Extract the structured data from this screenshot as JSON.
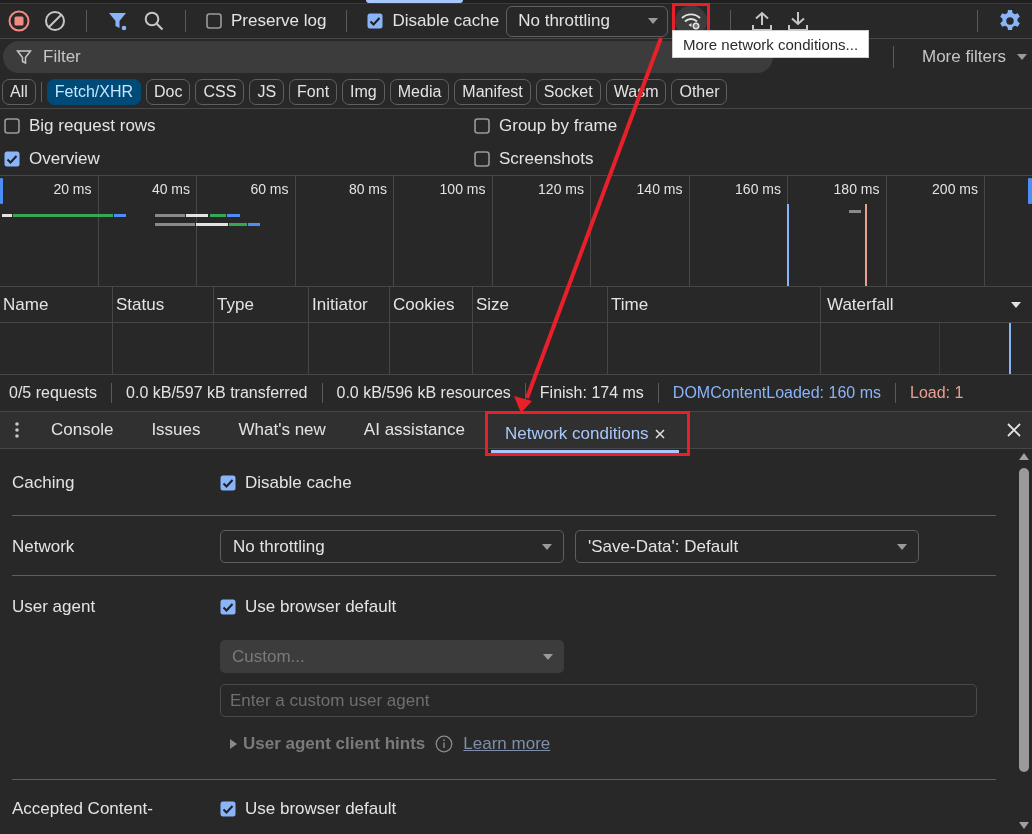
{
  "toolbar": {
    "recording": true,
    "preserve_log": {
      "label": "Preserve log",
      "checked": false
    },
    "disable_cache": {
      "label": "Disable cache",
      "checked": true
    },
    "throttling": "No throttling",
    "conditions_button": {
      "highlighted": true
    },
    "tooltip": "More network conditions..."
  },
  "filter": {
    "placeholder": "Filter",
    "more_filters": "More filters"
  },
  "type_filters": [
    {
      "label": "All",
      "selected": false
    },
    {
      "label": "Fetch/XHR",
      "selected": true
    },
    {
      "label": "Doc",
      "selected": false
    },
    {
      "label": "CSS",
      "selected": false
    },
    {
      "label": "JS",
      "selected": false
    },
    {
      "label": "Font",
      "selected": false
    },
    {
      "label": "Img",
      "selected": false
    },
    {
      "label": "Media",
      "selected": false
    },
    {
      "label": "Manifest",
      "selected": false
    },
    {
      "label": "Socket",
      "selected": false
    },
    {
      "label": "Wasm",
      "selected": false
    },
    {
      "label": "Other",
      "selected": false
    }
  ],
  "options": [
    {
      "label": "Big request rows",
      "checked": false
    },
    {
      "label": "Group by frame",
      "checked": false
    },
    {
      "label": "Overview",
      "checked": true
    },
    {
      "label": "Screenshots",
      "checked": false
    }
  ],
  "overview": {
    "ticks": [
      "20 ms",
      "40 ms",
      "60 ms",
      "80 ms",
      "100 ms",
      "120 ms",
      "140 ms",
      "160 ms",
      "180 ms",
      "200 ms"
    ]
  },
  "table": {
    "columns": [
      "Name",
      "Status",
      "Type",
      "Initiator",
      "Cookies",
      "Size",
      "Time",
      "Waterfall"
    ]
  },
  "status_bar": [
    {
      "text": "0/5 requests",
      "kind": "plain"
    },
    {
      "text": "0.0 kB/597 kB transferred",
      "kind": "plain"
    },
    {
      "text": "0.0 kB/596 kB resources",
      "kind": "plain"
    },
    {
      "text": "Finish: 174 ms",
      "kind": "plain"
    },
    {
      "text": "DOMContentLoaded: 160 ms",
      "kind": "dom"
    },
    {
      "text": "Load: 1",
      "kind": "load"
    }
  ],
  "drawer": {
    "tabs": [
      {
        "label": "Console",
        "selected": false,
        "closable": false,
        "highlighted": false
      },
      {
        "label": "Issues",
        "selected": false,
        "closable": false,
        "highlighted": false
      },
      {
        "label": "What's new",
        "selected": false,
        "closable": false,
        "highlighted": false
      },
      {
        "label": "AI assistance",
        "selected": false,
        "closable": false,
        "highlighted": false
      },
      {
        "label": "Network conditions",
        "selected": true,
        "closable": true,
        "highlighted": true
      }
    ]
  },
  "conditions": [
    {
      "kind": "checkbox",
      "label": "Caching",
      "checkbox": {
        "label": "Disable cache",
        "checked": true
      }
    },
    {
      "kind": "selects",
      "label": "Network",
      "selects": [
        "No throttling",
        "'Save-Data': Default"
      ]
    },
    {
      "kind": "user_agent",
      "label": "User agent",
      "checkbox": {
        "label": "Use browser default",
        "checked": true
      },
      "custom_select": {
        "value": "Custom...",
        "disabled": true
      },
      "input": {
        "placeholder": "Enter a custom user agent"
      },
      "hints": {
        "label": "User agent client hints",
        "link": "Learn more"
      }
    },
    {
      "kind": "checkbox",
      "label": "Accepted Content-",
      "checkbox": {
        "label": "Use browser default",
        "checked": true
      }
    }
  ],
  "annotation_arrow": true
}
